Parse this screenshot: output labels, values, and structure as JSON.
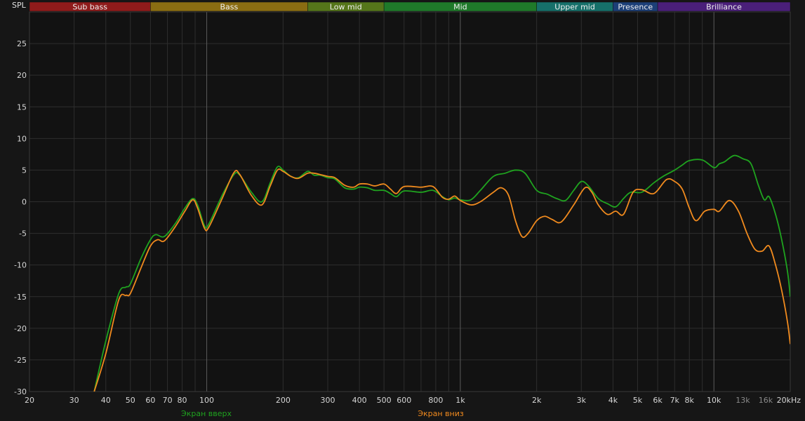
{
  "chart_data": {
    "type": "line",
    "ylabel": "SPL",
    "xscale": "log",
    "xlim": [
      20,
      20000
    ],
    "ylim": [
      -30,
      30
    ],
    "grid": true,
    "legend_position": "bottom",
    "y_ticks": [
      -30,
      -25,
      -20,
      -15,
      -10,
      -5,
      0,
      5,
      10,
      15,
      20,
      25
    ],
    "x_ticks": [
      {
        "value": 20,
        "label": "20"
      },
      {
        "value": 30,
        "label": "30"
      },
      {
        "value": 40,
        "label": "40"
      },
      {
        "value": 50,
        "label": "50"
      },
      {
        "value": 60,
        "label": "60"
      },
      {
        "value": 70,
        "label": "70"
      },
      {
        "value": 80,
        "label": "80"
      },
      {
        "value": 100,
        "label": "100"
      },
      {
        "value": 200,
        "label": "200"
      },
      {
        "value": 300,
        "label": "300"
      },
      {
        "value": 400,
        "label": "400"
      },
      {
        "value": 500,
        "label": "500"
      },
      {
        "value": 600,
        "label": "600"
      },
      {
        "value": 800,
        "label": "800"
      },
      {
        "value": 1000,
        "label": "1k"
      },
      {
        "value": 2000,
        "label": "2k"
      },
      {
        "value": 3000,
        "label": "3k"
      },
      {
        "value": 4000,
        "label": "4k"
      },
      {
        "value": 5000,
        "label": "5k"
      },
      {
        "value": 6000,
        "label": "6k"
      },
      {
        "value": 7000,
        "label": "7k"
      },
      {
        "value": 8000,
        "label": "8k"
      },
      {
        "value": 10000,
        "label": "10k"
      },
      {
        "value": 13000,
        "label": "13k",
        "dim": true
      },
      {
        "value": 16000,
        "label": "16k",
        "dim": true
      },
      {
        "value": 20000,
        "label": "20kHz"
      }
    ],
    "bands": [
      {
        "name": "Sub bass",
        "from": 20,
        "to": 60,
        "color": "#8f1b1b"
      },
      {
        "name": "Bass",
        "from": 60,
        "to": 250,
        "color": "#8a6d12"
      },
      {
        "name": "Low mid",
        "from": 250,
        "to": 500,
        "color": "#55761a"
      },
      {
        "name": "Mid",
        "from": 500,
        "to": 2000,
        "color": "#1f7a2a"
      },
      {
        "name": "Upper mid",
        "from": 2000,
        "to": 4000,
        "color": "#16706a"
      },
      {
        "name": "Presence",
        "from": 4000,
        "to": 6000,
        "color": "#1c3f78"
      },
      {
        "name": "Brilliance",
        "from": 6000,
        "to": 20000,
        "color": "#4a1f7a"
      }
    ],
    "series": [
      {
        "name": "Экран вверх",
        "color": "#1fa31f",
        "points": [
          [
            36,
            -30
          ],
          [
            40,
            -22
          ],
          [
            45,
            -14.5
          ],
          [
            48,
            -13.5
          ],
          [
            50,
            -13
          ],
          [
            55,
            -9
          ],
          [
            60,
            -6
          ],
          [
            63,
            -5.2
          ],
          [
            68,
            -5.5
          ],
          [
            75,
            -3.5
          ],
          [
            82,
            -1
          ],
          [
            88,
            0.5
          ],
          [
            92,
            -0.5
          ],
          [
            98,
            -3.8
          ],
          [
            102,
            -3.5
          ],
          [
            115,
            1
          ],
          [
            128,
            4.3
          ],
          [
            135,
            4.2
          ],
          [
            150,
            1.5
          ],
          [
            165,
            0
          ],
          [
            178,
            3
          ],
          [
            190,
            5.5
          ],
          [
            200,
            5
          ],
          [
            215,
            4
          ],
          [
            230,
            3.8
          ],
          [
            250,
            4.8
          ],
          [
            265,
            4.2
          ],
          [
            280,
            4.2
          ],
          [
            300,
            3.8
          ],
          [
            320,
            3.6
          ],
          [
            350,
            2.2
          ],
          [
            380,
            2
          ],
          [
            400,
            2.3
          ],
          [
            430,
            2.2
          ],
          [
            460,
            1.8
          ],
          [
            500,
            1.8
          ],
          [
            530,
            1.3
          ],
          [
            560,
            0.8
          ],
          [
            600,
            1.7
          ],
          [
            700,
            1.5
          ],
          [
            780,
            1.8
          ],
          [
            850,
            0.8
          ],
          [
            900,
            0.3
          ],
          [
            950,
            0.6
          ],
          [
            1000,
            0.3
          ],
          [
            1100,
            0.3
          ],
          [
            1200,
            1.8
          ],
          [
            1350,
            4
          ],
          [
            1500,
            4.5
          ],
          [
            1650,
            5
          ],
          [
            1800,
            4.5
          ],
          [
            2000,
            1.8
          ],
          [
            2200,
            1.2
          ],
          [
            2400,
            0.5
          ],
          [
            2600,
            0.2
          ],
          [
            2800,
            1.8
          ],
          [
            3000,
            3.2
          ],
          [
            3200,
            2.5
          ],
          [
            3500,
            0.5
          ],
          [
            3800,
            -0.3
          ],
          [
            4100,
            -0.8
          ],
          [
            4400,
            0.5
          ],
          [
            4700,
            1.5
          ],
          [
            5200,
            1.5
          ],
          [
            5800,
            3
          ],
          [
            6300,
            4
          ],
          [
            7000,
            5
          ],
          [
            7500,
            5.8
          ],
          [
            8000,
            6.5
          ],
          [
            9000,
            6.6
          ],
          [
            10000,
            5.4
          ],
          [
            10500,
            6
          ],
          [
            11000,
            6.3
          ],
          [
            12000,
            7.3
          ],
          [
            13000,
            6.8
          ],
          [
            14000,
            6
          ],
          [
            15000,
            2.5
          ],
          [
            15800,
            0.3
          ],
          [
            16500,
            0.8
          ],
          [
            17500,
            -2
          ],
          [
            18500,
            -6
          ],
          [
            19500,
            -11
          ],
          [
            20000,
            -15
          ]
        ]
      },
      {
        "name": "Экран вниз",
        "color": "#f08a1e",
        "points": [
          [
            36,
            -30
          ],
          [
            40,
            -24
          ],
          [
            45,
            -15.5
          ],
          [
            48,
            -14.8
          ],
          [
            50,
            -14.5
          ],
          [
            55,
            -10.5
          ],
          [
            60,
            -7
          ],
          [
            64,
            -6
          ],
          [
            68,
            -6.2
          ],
          [
            75,
            -4
          ],
          [
            82,
            -1.5
          ],
          [
            88,
            0.3
          ],
          [
            92,
            -1
          ],
          [
            98,
            -4.2
          ],
          [
            102,
            -4
          ],
          [
            115,
            0.5
          ],
          [
            128,
            4.6
          ],
          [
            135,
            4.3
          ],
          [
            150,
            1
          ],
          [
            165,
            -0.5
          ],
          [
            178,
            2.5
          ],
          [
            190,
            5
          ],
          [
            200,
            4.8
          ],
          [
            215,
            4
          ],
          [
            230,
            3.7
          ],
          [
            250,
            4.5
          ],
          [
            265,
            4.5
          ],
          [
            280,
            4.3
          ],
          [
            300,
            4
          ],
          [
            320,
            3.8
          ],
          [
            350,
            2.6
          ],
          [
            380,
            2.3
          ],
          [
            400,
            2.8
          ],
          [
            430,
            2.8
          ],
          [
            460,
            2.5
          ],
          [
            500,
            2.8
          ],
          [
            530,
            2
          ],
          [
            560,
            1.3
          ],
          [
            600,
            2.4
          ],
          [
            700,
            2.3
          ],
          [
            780,
            2.4
          ],
          [
            850,
            0.7
          ],
          [
            900,
            0.4
          ],
          [
            950,
            0.9
          ],
          [
            1000,
            0.2
          ],
          [
            1100,
            -0.5
          ],
          [
            1200,
            0
          ],
          [
            1350,
            1.5
          ],
          [
            1450,
            2.2
          ],
          [
            1550,
            1
          ],
          [
            1650,
            -3
          ],
          [
            1750,
            -5.5
          ],
          [
            1850,
            -5
          ],
          [
            2000,
            -3
          ],
          [
            2150,
            -2.3
          ],
          [
            2300,
            -2.8
          ],
          [
            2500,
            -3.2
          ],
          [
            2800,
            -0.5
          ],
          [
            3100,
            2.2
          ],
          [
            3300,
            1.5
          ],
          [
            3500,
            -0.5
          ],
          [
            3800,
            -2
          ],
          [
            4100,
            -1.5
          ],
          [
            4400,
            -2
          ],
          [
            4800,
            1.5
          ],
          [
            5200,
            1.9
          ],
          [
            5800,
            1.3
          ],
          [
            6500,
            3.5
          ],
          [
            7000,
            3.2
          ],
          [
            7500,
            2
          ],
          [
            8000,
            -1
          ],
          [
            8500,
            -3
          ],
          [
            9200,
            -1.5
          ],
          [
            10000,
            -1.2
          ],
          [
            10500,
            -1.5
          ],
          [
            11500,
            0.2
          ],
          [
            12500,
            -1.5
          ],
          [
            13500,
            -5
          ],
          [
            14500,
            -7.5
          ],
          [
            15500,
            -7.8
          ],
          [
            16500,
            -7
          ],
          [
            17500,
            -10
          ],
          [
            18500,
            -14
          ],
          [
            19500,
            -19
          ],
          [
            20000,
            -22.5
          ]
        ]
      }
    ]
  }
}
